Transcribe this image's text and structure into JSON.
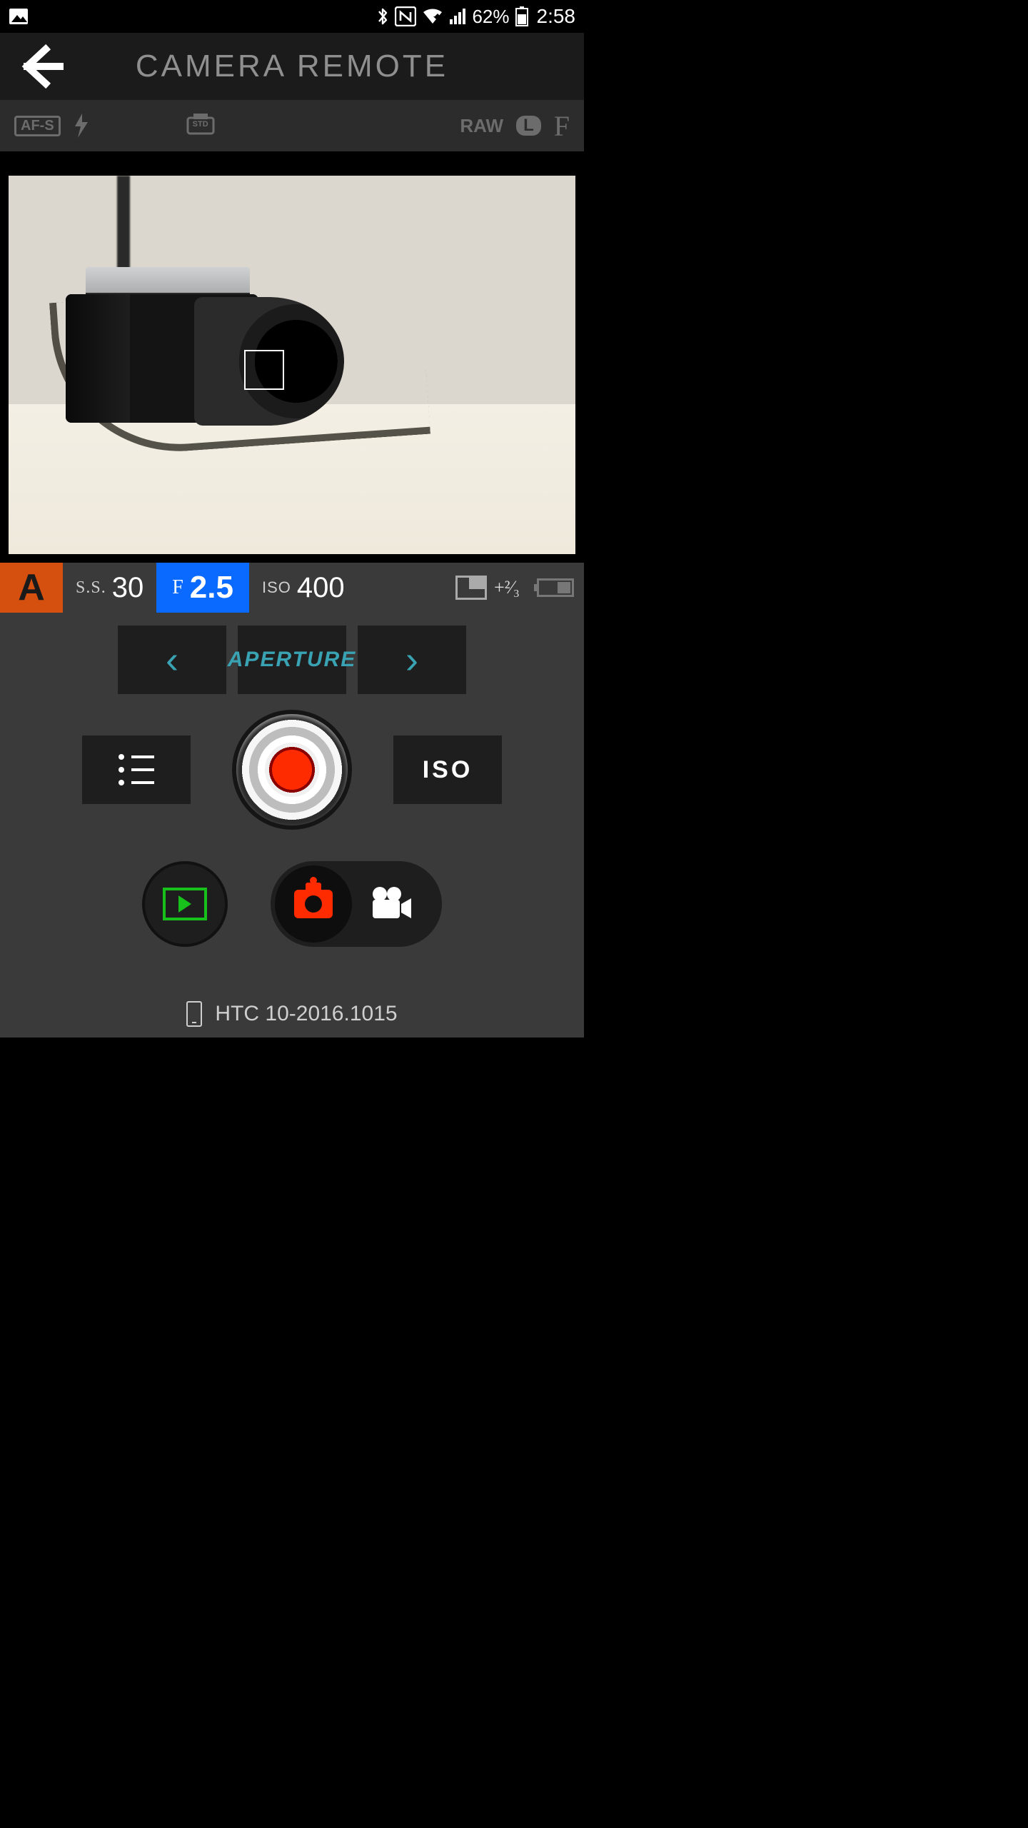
{
  "status": {
    "battery_pct": "62%",
    "time": "2:58"
  },
  "header": {
    "title": "CAMERA REMOTE"
  },
  "camera_strip": {
    "af_mode": "AF-S",
    "film_sim": "STD",
    "raw": "RAW",
    "size": "L",
    "aspect": "F"
  },
  "exposure": {
    "mode": "A",
    "ss_label": "S.S.",
    "ss_value": "30",
    "f_label": "F",
    "f_value": "2.5",
    "iso_label": "ISO",
    "iso_value": "400",
    "ev_value": "+²⁄₃"
  },
  "selector": {
    "label": "APERTURE"
  },
  "buttons": {
    "iso": "ISO"
  },
  "device": {
    "name": "HTC 10-2016.1015"
  }
}
